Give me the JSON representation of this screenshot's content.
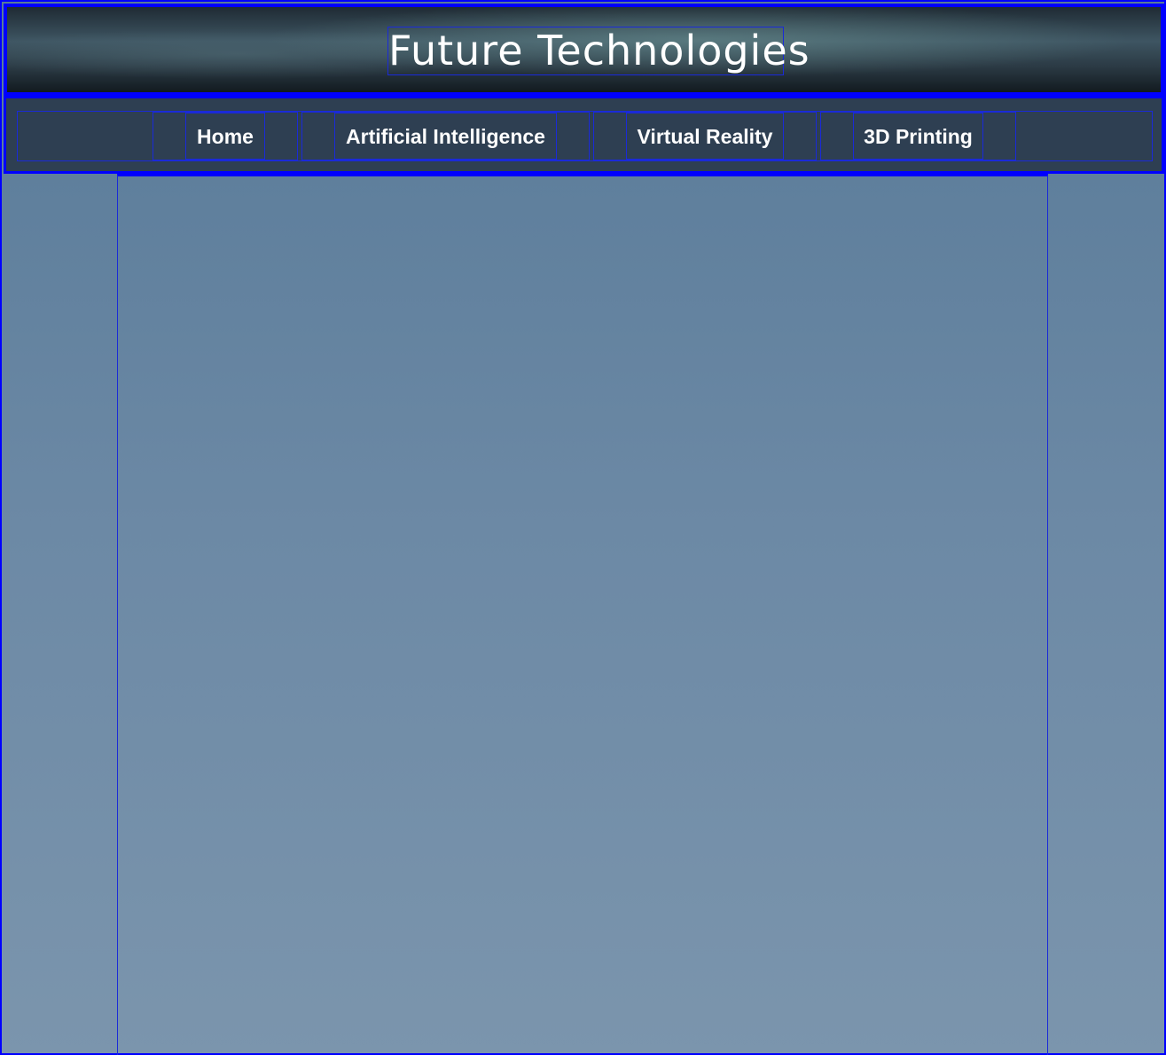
{
  "header": {
    "title": "Future Technologies"
  },
  "nav": {
    "items": [
      {
        "label": "Home"
      },
      {
        "label": "Artificial Intelligence"
      },
      {
        "label": "Virtual Reality"
      },
      {
        "label": "3D Printing"
      }
    ]
  },
  "colors": {
    "outline": "#0000ff",
    "nav_background": "#2e3f52",
    "page_background_top": "#587a98",
    "page_background_bottom": "#7b95ad",
    "text": "#ffffff"
  }
}
